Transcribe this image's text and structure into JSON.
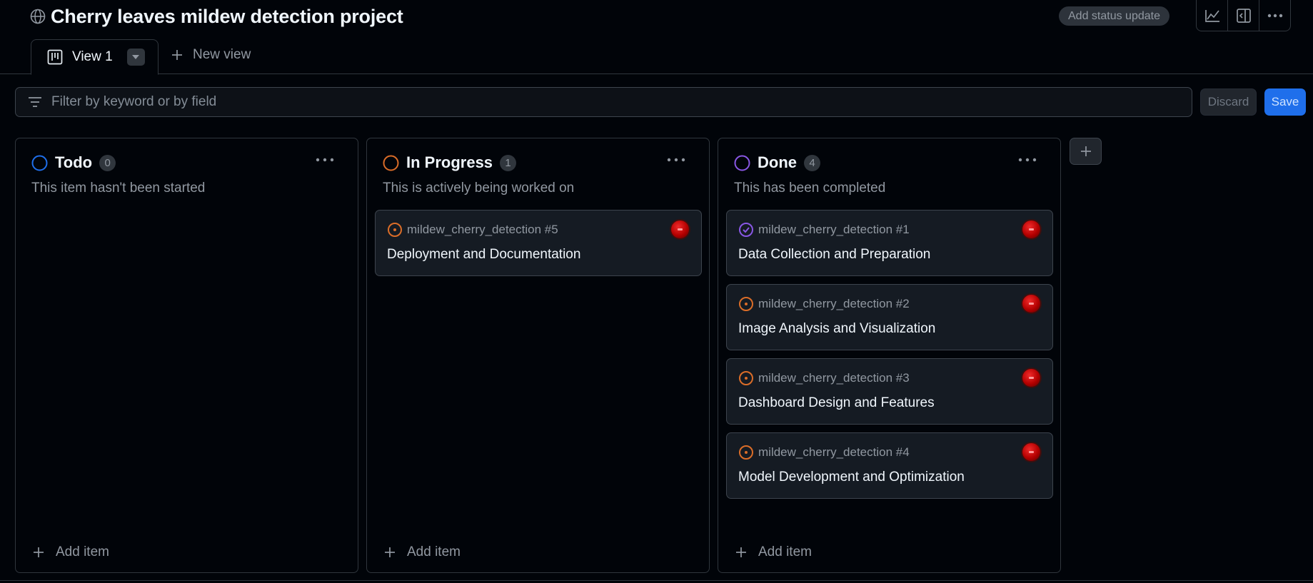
{
  "project": {
    "title": "Cherry leaves mildew detection project",
    "status_update_label": "Add status update"
  },
  "toolbar": {
    "icons": [
      "insights-icon",
      "side-panel-icon",
      "more-options-icon"
    ]
  },
  "views": {
    "active_tab": "View 1",
    "new_view_label": "New view"
  },
  "filter": {
    "placeholder": "Filter by keyword or by field",
    "value": "",
    "discard_label": "Discard",
    "save_label": "Save"
  },
  "colors": {
    "accent": "#1f6feb",
    "todo": "#1f6feb",
    "in_progress": "#db6d28",
    "done": "#8957e5",
    "open_issue": "#db6d28"
  },
  "columns": [
    {
      "name": "Todo",
      "count": "0",
      "description": "This item hasn't been started",
      "add_label": "Add item",
      "cards": []
    },
    {
      "name": "In Progress",
      "count": "1",
      "description": "This is actively being worked on",
      "add_label": "Add item",
      "cards": [
        {
          "ref": "mildew_cherry_detection #5",
          "title": "Deployment and Documentation",
          "status": "open"
        }
      ]
    },
    {
      "name": "Done",
      "count": "4",
      "description": "This has been completed",
      "add_label": "Add item",
      "cards": [
        {
          "ref": "mildew_cherry_detection #1",
          "title": "Data Collection and Preparation",
          "status": "closed"
        },
        {
          "ref": "mildew_cherry_detection #2",
          "title": "Image Analysis and Visualization",
          "status": "open"
        },
        {
          "ref": "mildew_cherry_detection #3",
          "title": "Dashboard Design and Features",
          "status": "open"
        },
        {
          "ref": "mildew_cherry_detection #4",
          "title": "Model Development and Optimization",
          "status": "open"
        }
      ]
    }
  ]
}
